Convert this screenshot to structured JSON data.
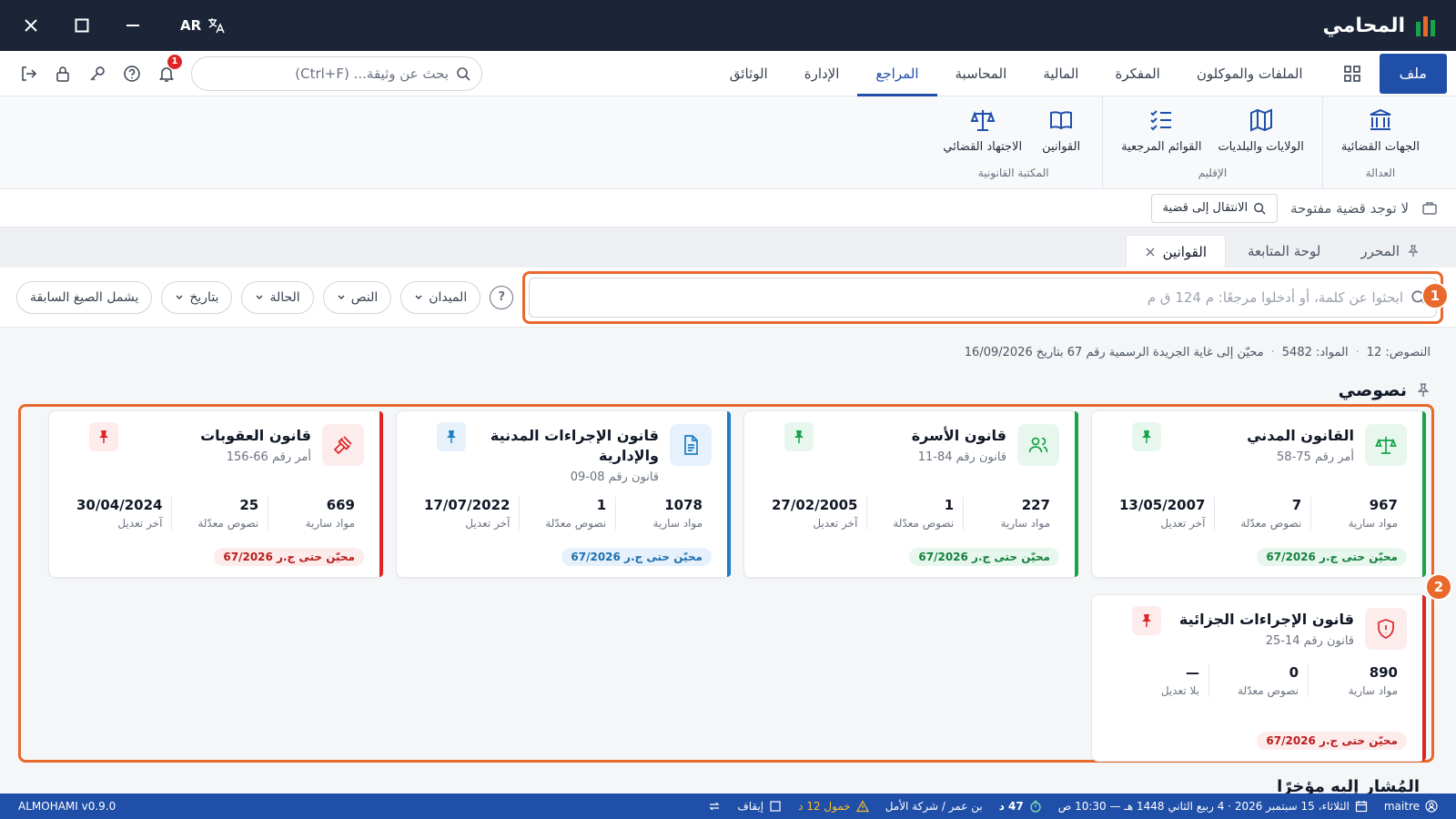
{
  "window": {
    "app_name": "المحامي",
    "lang": "AR"
  },
  "menu": {
    "file": "ملف",
    "tabs": [
      "الملفات والموكلون",
      "المفكرة",
      "المالية",
      "المحاسبة",
      "المراجع",
      "الإدارة",
      "الوثائق"
    ],
    "active_tab": "المراجع",
    "search_placeholder": "بحث عن وثيقة... (Ctrl+F)",
    "notifications_count": "1"
  },
  "ribbon": {
    "groups": [
      {
        "label": "العدالة",
        "items": [
          {
            "label": "الجهات القضائية",
            "icon": "courthouse-icon"
          }
        ]
      },
      {
        "label": "الإقليم",
        "items": [
          {
            "label": "الولايات والبلديات",
            "icon": "map-icon"
          },
          {
            "label": "القوائم المرجعية",
            "icon": "checklist-icon"
          }
        ]
      },
      {
        "label": "المكتبة القانونية",
        "items": [
          {
            "label": "القوانين",
            "icon": "book-icon"
          },
          {
            "label": "الاجتهاد القضائي",
            "icon": "scale-icon"
          }
        ]
      }
    ]
  },
  "casebar": {
    "no_case": "لا توجد قضية مفتوحة",
    "goto_case": "الانتقال إلى قضية"
  },
  "doctabs": [
    {
      "label": "المحرر",
      "pinned": true
    },
    {
      "label": "لوحة المتابعة"
    },
    {
      "label": "القوانين",
      "active": true,
      "closable": true
    }
  ],
  "filters": {
    "search_placeholder": "ابحثوا عن كلمة، أو أدخلوا مرجعًا: م 124 ق م",
    "chips": [
      "الميدان",
      "النص",
      "الحالة",
      "بتاريخ"
    ],
    "toggle": "يشمل الصيغ السابقة"
  },
  "markers": {
    "m1": "1",
    "m2": "2"
  },
  "summary": {
    "texts": "النصوص: 12",
    "articles": "المواد: 5482",
    "updated": "محيّن إلى غاية الجريدة الرسمية رقم 67 بتاريخ 16/09/2026"
  },
  "section_title": "نصوصي",
  "cards": [
    {
      "title": "القانون المدني",
      "subtitle": "أمر رقم 75-58",
      "icon": "scale-icon",
      "color": "#16a34a",
      "tint": "#e8f7ee",
      "stats": [
        {
          "v": "967",
          "l": "مواد سارية"
        },
        {
          "v": "7",
          "l": "نصوص معدّلة"
        },
        {
          "v": "13/05/2007",
          "l": "آخر تعديل"
        }
      ],
      "tag": "محيّن حتى ج.ر 67/2026"
    },
    {
      "title": "قانون الأسرة",
      "subtitle": "قانون رقم 84-11",
      "icon": "users-icon",
      "color": "#16a34a",
      "tint": "#e8f7ee",
      "stats": [
        {
          "v": "227",
          "l": "مواد سارية"
        },
        {
          "v": "1",
          "l": "نصوص معدّلة"
        },
        {
          "v": "27/02/2005",
          "l": "آخر تعديل"
        }
      ],
      "tag": "محيّن حتى ج.ر 67/2026"
    },
    {
      "title": "قانون الإجراءات المدنية والإدارية",
      "subtitle": "قانون رقم 08-09",
      "icon": "document-icon",
      "color": "#1d7fc4",
      "tint": "#e6f1fb",
      "stats": [
        {
          "v": "1078",
          "l": "مواد سارية"
        },
        {
          "v": "1",
          "l": "نصوص معدّلة"
        },
        {
          "v": "17/07/2022",
          "l": "آخر تعديل"
        }
      ],
      "tag": "محيّن حتى ج.ر 67/2026"
    },
    {
      "title": "قانون العقوبات",
      "subtitle": "أمر رقم 66-156",
      "icon": "gavel-icon",
      "color": "#dc2626",
      "tint": "#fdecec",
      "stats": [
        {
          "v": "669",
          "l": "مواد سارية"
        },
        {
          "v": "25",
          "l": "نصوص معدّلة"
        },
        {
          "v": "30/04/2024",
          "l": "آخر تعديل"
        }
      ],
      "tag": "محيّن حتى ج.ر 67/2026"
    },
    {
      "title": "قانون الإجراءات الجزائية",
      "subtitle": "قانون رقم 14-25",
      "icon": "shield-icon",
      "color": "#dc2626",
      "tint": "#fdecec",
      "stats": [
        {
          "v": "890",
          "l": "مواد سارية"
        },
        {
          "v": "0",
          "l": "نصوص معدّلة"
        },
        {
          "v": "—",
          "l": "بلا تعديل"
        }
      ],
      "tag": "محيّن حتى ج.ر 67/2026"
    }
  ],
  "bottom_heading": "المُشار إليه مؤخرًا",
  "status": {
    "user": "maitre",
    "datetime": "الثلاثاء، 15 سبتمبر 2026 · 4 ربيع الثاني 1448 هـ — 10:30 ص",
    "office": "بن عمر / شركة الأمل",
    "timer": "47 د",
    "idle": "خمول 12 د",
    "pause": "إيقاف",
    "version": "ALMOHAMI v0.9.0"
  }
}
